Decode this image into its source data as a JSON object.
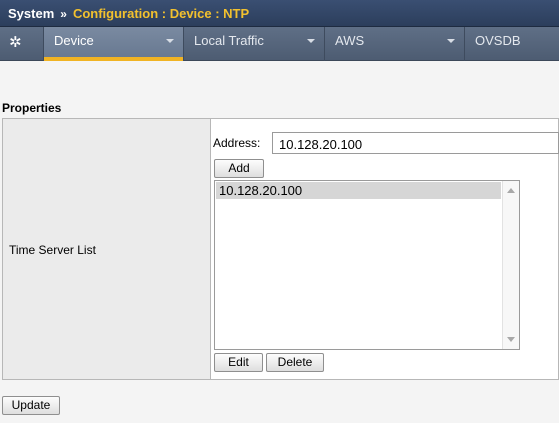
{
  "header": {
    "system": "System",
    "separator": "»",
    "breadcrumb": "Configuration : Device : NTP"
  },
  "tabs": [
    {
      "label": "Device",
      "active": true
    },
    {
      "label": "Local Traffic",
      "active": false
    },
    {
      "label": "AWS",
      "active": false
    },
    {
      "label": "OVSDB",
      "active": false
    }
  ],
  "gear_menu": {
    "icon": "gear-icon"
  },
  "properties": {
    "title": "Properties",
    "row_label": "Time Server List",
    "address_label": "Address:",
    "address_value": "10.128.20.100",
    "add_label": "Add",
    "servers": [
      "10.128.20.100"
    ],
    "edit_label": "Edit",
    "delete_label": "Delete"
  },
  "update_label": "Update",
  "colors": {
    "accent": "#f0b323",
    "breadcrumb": "#f2c12e",
    "titlebar": "#2c3e5c"
  }
}
